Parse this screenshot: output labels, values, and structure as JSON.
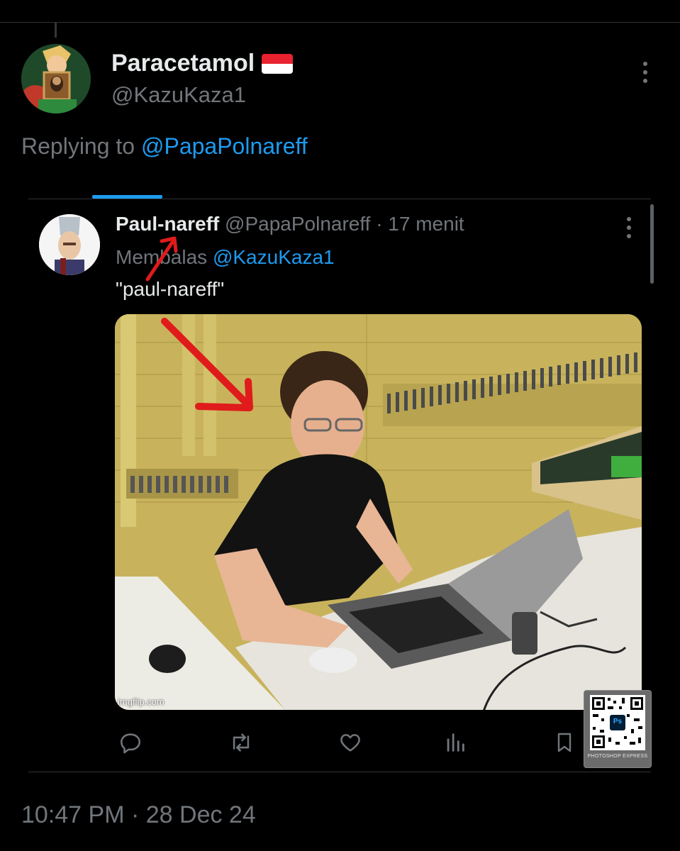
{
  "main_tweet": {
    "display_name": "Paracetamol",
    "handle": "@KazuKaza1",
    "replying_prefix": "Replying to",
    "replying_to": "@PapaPolnareff",
    "timestamp": "10:47 PM · 28 Dec 24"
  },
  "quoted_reply": {
    "display_name": "Paul-nareff",
    "handle": "@PapaPolnareff",
    "time": "· 17 menit",
    "replying_prefix": "Membalas",
    "replying_to": "@KazuKaza1",
    "text": "\"paul-nareff\"",
    "image_watermark": "imgflip.com"
  },
  "actions": [
    "reply-icon",
    "repost-icon",
    "like-icon",
    "views-icon",
    "bookmark-icon"
  ],
  "overlay": {
    "app_badge": "Ps",
    "label": "PHOTOSHOP EXPRESS"
  },
  "colors": {
    "background": "#000000",
    "text": "#e7e9ea",
    "muted": "#71767b",
    "accent": "#1d9bf0",
    "annotation_arrow": "#e01b1b"
  }
}
